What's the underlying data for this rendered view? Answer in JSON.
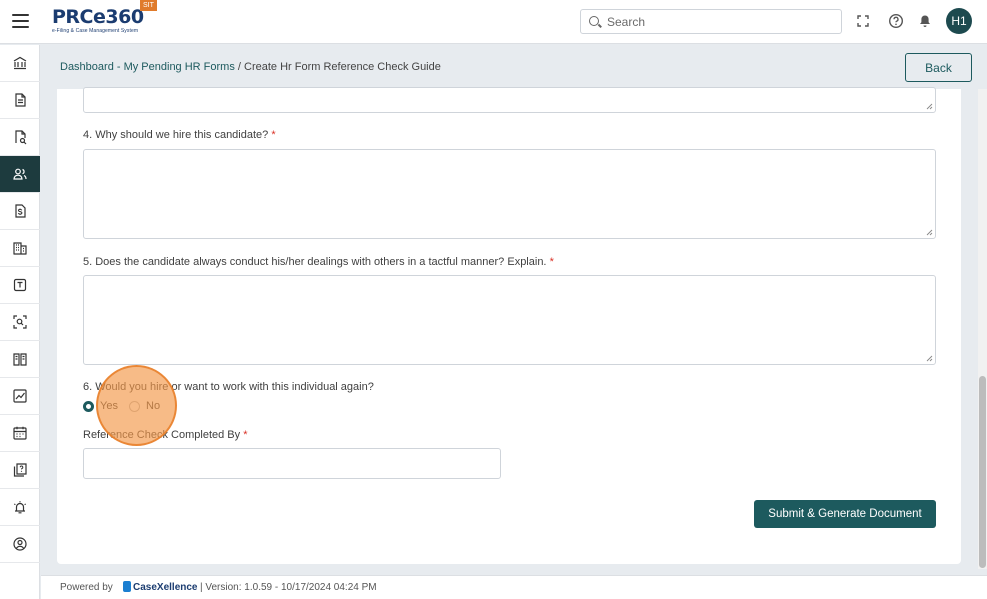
{
  "header": {
    "logo_text": "PRCe360",
    "logo_subtitle": "e-Filing & Case Management System",
    "env_badge": "SIT",
    "search_placeholder": "Search",
    "avatar_initials": "H1"
  },
  "sidebar": {
    "items": [
      {
        "icon": "bank-icon",
        "active": false
      },
      {
        "icon": "document-icon",
        "active": false
      },
      {
        "icon": "document-search-icon",
        "active": false
      },
      {
        "icon": "users-icon",
        "active": true
      },
      {
        "icon": "dollar-document-icon",
        "active": false
      },
      {
        "icon": "building-icon",
        "active": false
      },
      {
        "icon": "template-icon",
        "active": false
      },
      {
        "icon": "scan-icon",
        "active": false
      },
      {
        "icon": "book-icon",
        "active": false
      },
      {
        "icon": "chart-icon",
        "active": false
      },
      {
        "icon": "calendar-icon",
        "active": false
      },
      {
        "icon": "help-document-icon",
        "active": false
      },
      {
        "icon": "alarm-icon",
        "active": false
      },
      {
        "icon": "profile-icon",
        "active": false
      }
    ]
  },
  "breadcrumb": {
    "link": "Dashboard - My Pending HR Forms",
    "separator": " / ",
    "current": "Create Hr Form Reference Check Guide"
  },
  "back_label": "Back",
  "form": {
    "q4_label": "4. Why should we hire this candidate?",
    "q5_label": "5. Does the candidate always conduct his/her dealings with others in a tactful manner? Explain.",
    "q6_label": "6. Would you hire or want to work with this individual again?",
    "q6_options": [
      "Yes",
      "No"
    ],
    "q6_selected": "Yes",
    "completed_by_label": "Reference Check Completed By",
    "required_mark": "*",
    "submit_label": "Submit & Generate Document"
  },
  "footer": {
    "powered_by": "Powered by",
    "brand": "CaseXellence",
    "version": "|   Version: 1.0.59 - 10/17/2024 04:24 PM"
  },
  "colors": {
    "primary": "#1d5a5e",
    "sidebar_active": "#1d3b3e",
    "env_badge": "#e07b2b",
    "required": "#d93025"
  }
}
